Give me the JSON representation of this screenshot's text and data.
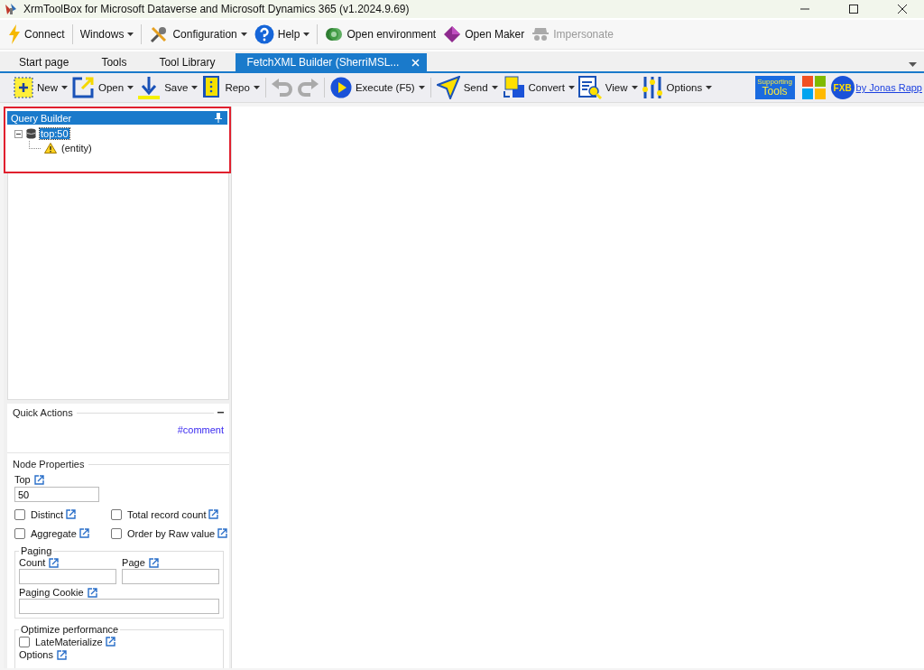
{
  "window": {
    "title": "XrmToolBox for Microsoft Dataverse and Microsoft Dynamics 365 (v1.2024.9.69)"
  },
  "menu": [
    {
      "label": "Connect",
      "dropdown": false,
      "disabled": false
    },
    {
      "label": "Windows",
      "dropdown": true,
      "disabled": false
    },
    {
      "label": "Configuration",
      "dropdown": true,
      "disabled": false
    },
    {
      "label": "Help",
      "dropdown": true,
      "disabled": false
    },
    {
      "label": "Open environment",
      "dropdown": false,
      "disabled": false
    },
    {
      "label": "Open Maker",
      "dropdown": false,
      "disabled": false
    },
    {
      "label": "Impersonate",
      "dropdown": false,
      "disabled": true
    }
  ],
  "tabs": [
    {
      "label": "Start page",
      "selected": false
    },
    {
      "label": "Tools",
      "selected": false
    },
    {
      "label": "Tool Library",
      "selected": false
    },
    {
      "label": "FetchXML Builder (SherriMSL...",
      "selected": true
    }
  ],
  "toolbar": [
    {
      "label": "New",
      "dropdown": true
    },
    {
      "label": "Open",
      "dropdown": true
    },
    {
      "label": "Save",
      "dropdown": true
    },
    {
      "label": "Repo",
      "dropdown": true
    },
    {
      "label": "Execute (F5)",
      "dropdown": true
    },
    {
      "label": "Send",
      "dropdown": true
    },
    {
      "label": "Convert",
      "dropdown": true
    },
    {
      "label": "View",
      "dropdown": true
    },
    {
      "label": "Options",
      "dropdown": true
    }
  ],
  "supporting_badge": {
    "line_1": "Supporting",
    "line_2": "Tools"
  },
  "logo_text": "FXB",
  "author_link": "by Jonas Rapp",
  "query_builder": {
    "title": "Query Builder",
    "tree": [
      {
        "label": "top:50",
        "selected": true,
        "expanded": true,
        "children": [
          {
            "label": "(entity)",
            "selected": false,
            "warning": true
          }
        ]
      }
    ]
  },
  "quick_actions": {
    "title": "Quick Actions",
    "links": [
      "#comment"
    ]
  },
  "node_properties": {
    "title": "Node Properties",
    "top": {
      "label": "Top",
      "value": "50"
    },
    "checkboxes": [
      {
        "label": "Distinct",
        "checked": false
      },
      {
        "label": "Total record count",
        "checked": false
      },
      {
        "label": "Aggregate",
        "checked": false
      },
      {
        "label": "Order by Raw value",
        "checked": false
      }
    ],
    "paging": {
      "title": "Paging",
      "fields": [
        {
          "label": "Count"
        },
        {
          "label": "Page"
        },
        {
          "label": "Paging Cookie"
        }
      ]
    },
    "optimize": {
      "title": "Optimize performance",
      "checkboxes": [
        {
          "label": "LateMaterialize",
          "checked": false
        }
      ],
      "options_label": "Options"
    }
  }
}
